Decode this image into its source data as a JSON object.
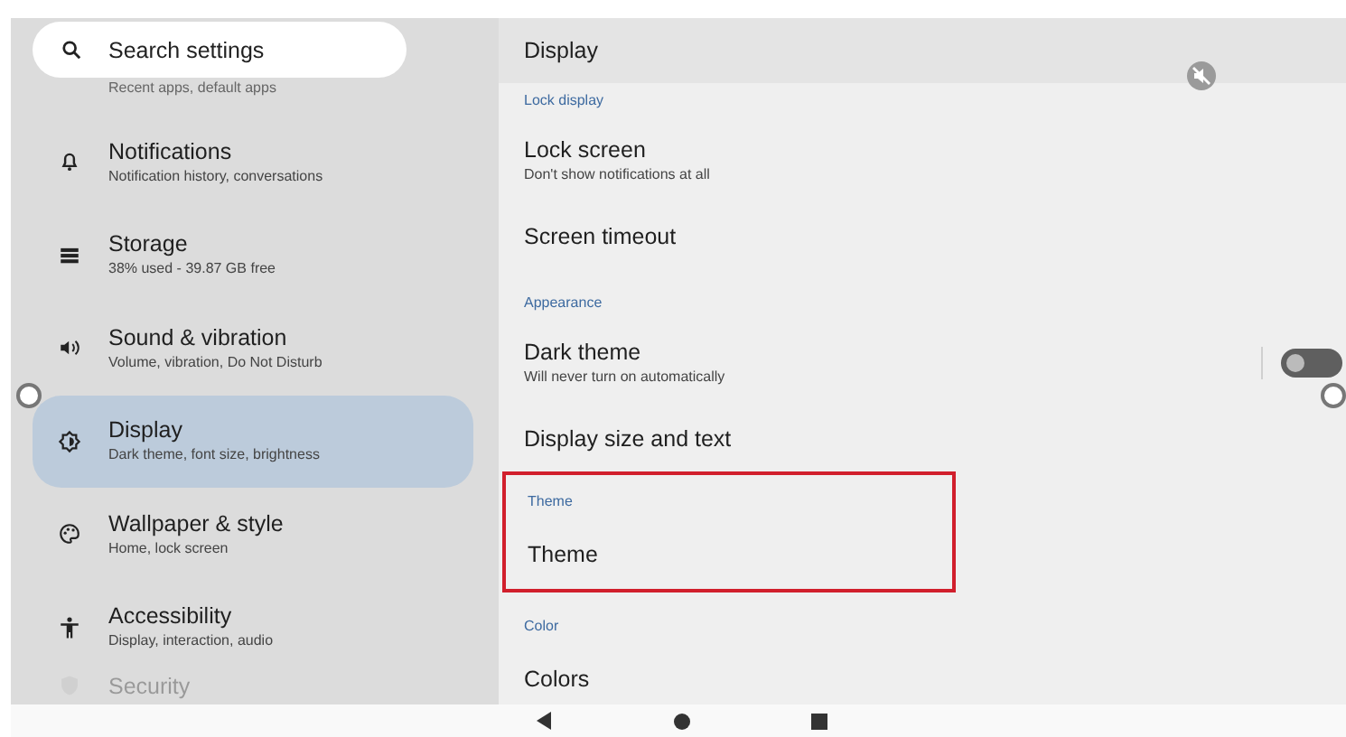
{
  "search": {
    "placeholder": "Search settings"
  },
  "sidebar": {
    "partial_top": "Recent apps, default apps",
    "items": [
      {
        "title": "Notifications",
        "subtitle": "Notification history, conversations",
        "selected": false
      },
      {
        "title": "Storage",
        "subtitle": "38% used - 39.87 GB free",
        "selected": false
      },
      {
        "title": "Sound & vibration",
        "subtitle": "Volume, vibration, Do Not Disturb",
        "selected": false
      },
      {
        "title": "Display",
        "subtitle": "Dark theme, font size, brightness",
        "selected": true
      },
      {
        "title": "Wallpaper & style",
        "subtitle": "Home, lock screen",
        "selected": false
      },
      {
        "title": "Accessibility",
        "subtitle": "Display, interaction, audio",
        "selected": false
      }
    ],
    "partial_bottom": {
      "title": "Security"
    }
  },
  "page": {
    "title": "Display",
    "sections": [
      {
        "heading": "Lock display",
        "highlighted": false,
        "rows": [
          {
            "title": "Lock screen",
            "subtitle": "Don't show notifications at all"
          },
          {
            "title": "Screen timeout"
          }
        ]
      },
      {
        "heading": "Appearance",
        "highlighted": false,
        "rows": [
          {
            "title": "Dark theme",
            "subtitle": "Will never turn on automatically",
            "toggle": {
              "on": false
            }
          },
          {
            "title": "Display size and text"
          }
        ]
      },
      {
        "heading": "Theme",
        "highlighted": true,
        "rows": [
          {
            "title": "Theme"
          }
        ]
      },
      {
        "heading": "Color",
        "highlighted": false,
        "rows": [
          {
            "title": "Colors"
          }
        ]
      }
    ]
  }
}
